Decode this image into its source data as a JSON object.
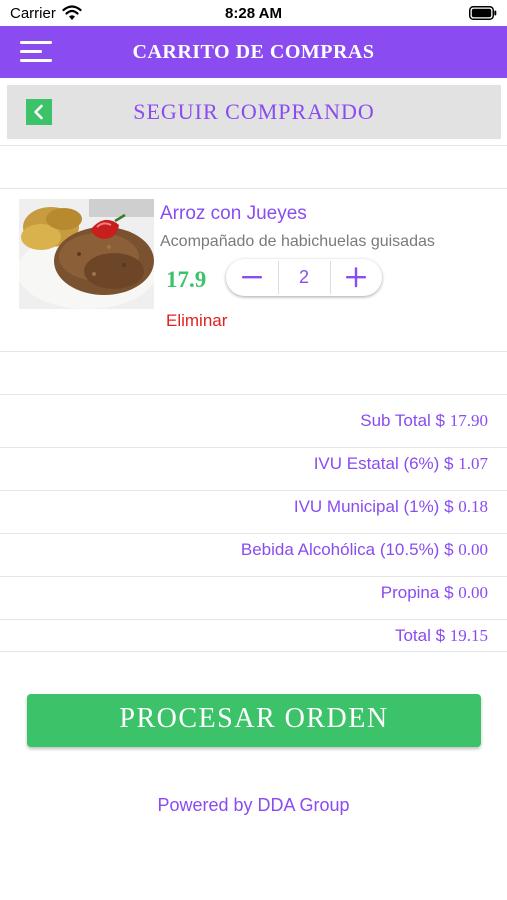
{
  "status_bar": {
    "carrier": "Carrier",
    "time": "8:28 AM"
  },
  "nav": {
    "title": "CARRITO DE COMPRAS",
    "menu_icon": "hamburger-menu-icon"
  },
  "seguir": {
    "label": "SEGUIR COMPRANDO",
    "back_icon": "chevron-left-icon"
  },
  "cart": {
    "items": [
      {
        "name": "Arroz con Jueyes",
        "description": "Acompañado de habichuelas guisadas",
        "price": "17.9",
        "quantity": "2",
        "remove_label": "Eliminar"
      }
    ]
  },
  "summary": {
    "subtotal": {
      "label": "Sub Total $ ",
      "value": "17.90"
    },
    "ivu_estatal": {
      "label": "IVU Estatal (6%) $ ",
      "value": "1.07"
    },
    "ivu_municipal": {
      "label": "IVU Municipal (1%) $ ",
      "value": "0.18"
    },
    "bebida": {
      "label": "Bebida Alcohólica (10.5%) $ ",
      "value": "0.00"
    },
    "propina": {
      "label": "Propina $ ",
      "value": "0.00"
    },
    "total": {
      "label": "Total $ ",
      "value": "19.15"
    }
  },
  "procesar_label": "PROCESAR ORDEN",
  "footer": "Powered by DDA Group",
  "colors": {
    "purple": "#8a4cf0",
    "green": "#3cc36a",
    "red": "#e02020",
    "gray_bar": "#e2e2e2"
  }
}
